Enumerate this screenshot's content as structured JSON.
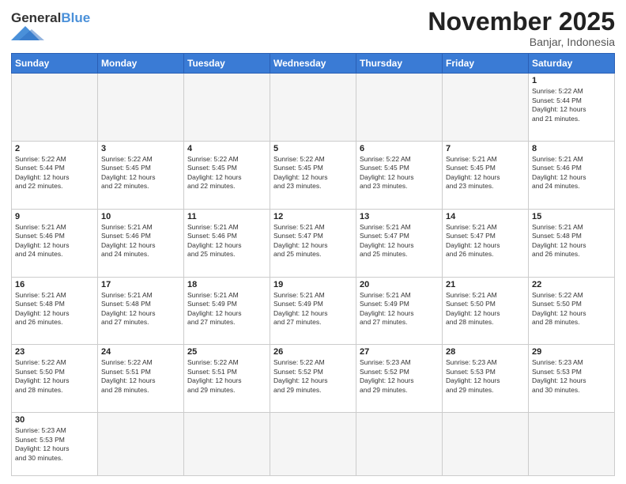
{
  "header": {
    "logo_general": "General",
    "logo_blue": "Blue",
    "month_title": "November 2025",
    "location": "Banjar, Indonesia"
  },
  "weekdays": [
    "Sunday",
    "Monday",
    "Tuesday",
    "Wednesday",
    "Thursday",
    "Friday",
    "Saturday"
  ],
  "days": {
    "1": {
      "sunrise": "5:22 AM",
      "sunset": "5:44 PM",
      "daylight": "12 hours and 21 minutes."
    },
    "2": {
      "sunrise": "5:22 AM",
      "sunset": "5:44 PM",
      "daylight": "12 hours and 22 minutes."
    },
    "3": {
      "sunrise": "5:22 AM",
      "sunset": "5:45 PM",
      "daylight": "12 hours and 22 minutes."
    },
    "4": {
      "sunrise": "5:22 AM",
      "sunset": "5:45 PM",
      "daylight": "12 hours and 22 minutes."
    },
    "5": {
      "sunrise": "5:22 AM",
      "sunset": "5:45 PM",
      "daylight": "12 hours and 23 minutes."
    },
    "6": {
      "sunrise": "5:22 AM",
      "sunset": "5:45 PM",
      "daylight": "12 hours and 23 minutes."
    },
    "7": {
      "sunrise": "5:21 AM",
      "sunset": "5:45 PM",
      "daylight": "12 hours and 23 minutes."
    },
    "8": {
      "sunrise": "5:21 AM",
      "sunset": "5:46 PM",
      "daylight": "12 hours and 24 minutes."
    },
    "9": {
      "sunrise": "5:21 AM",
      "sunset": "5:46 PM",
      "daylight": "12 hours and 24 minutes."
    },
    "10": {
      "sunrise": "5:21 AM",
      "sunset": "5:46 PM",
      "daylight": "12 hours and 24 minutes."
    },
    "11": {
      "sunrise": "5:21 AM",
      "sunset": "5:46 PM",
      "daylight": "12 hours and 25 minutes."
    },
    "12": {
      "sunrise": "5:21 AM",
      "sunset": "5:47 PM",
      "daylight": "12 hours and 25 minutes."
    },
    "13": {
      "sunrise": "5:21 AM",
      "sunset": "5:47 PM",
      "daylight": "12 hours and 25 minutes."
    },
    "14": {
      "sunrise": "5:21 AM",
      "sunset": "5:47 PM",
      "daylight": "12 hours and 26 minutes."
    },
    "15": {
      "sunrise": "5:21 AM",
      "sunset": "5:48 PM",
      "daylight": "12 hours and 26 minutes."
    },
    "16": {
      "sunrise": "5:21 AM",
      "sunset": "5:48 PM",
      "daylight": "12 hours and 26 minutes."
    },
    "17": {
      "sunrise": "5:21 AM",
      "sunset": "5:48 PM",
      "daylight": "12 hours and 27 minutes."
    },
    "18": {
      "sunrise": "5:21 AM",
      "sunset": "5:49 PM",
      "daylight": "12 hours and 27 minutes."
    },
    "19": {
      "sunrise": "5:21 AM",
      "sunset": "5:49 PM",
      "daylight": "12 hours and 27 minutes."
    },
    "20": {
      "sunrise": "5:21 AM",
      "sunset": "5:49 PM",
      "daylight": "12 hours and 27 minutes."
    },
    "21": {
      "sunrise": "5:21 AM",
      "sunset": "5:50 PM",
      "daylight": "12 hours and 28 minutes."
    },
    "22": {
      "sunrise": "5:22 AM",
      "sunset": "5:50 PM",
      "daylight": "12 hours and 28 minutes."
    },
    "23": {
      "sunrise": "5:22 AM",
      "sunset": "5:50 PM",
      "daylight": "12 hours and 28 minutes."
    },
    "24": {
      "sunrise": "5:22 AM",
      "sunset": "5:51 PM",
      "daylight": "12 hours and 28 minutes."
    },
    "25": {
      "sunrise": "5:22 AM",
      "sunset": "5:51 PM",
      "daylight": "12 hours and 29 minutes."
    },
    "26": {
      "sunrise": "5:22 AM",
      "sunset": "5:52 PM",
      "daylight": "12 hours and 29 minutes."
    },
    "27": {
      "sunrise": "5:23 AM",
      "sunset": "5:52 PM",
      "daylight": "12 hours and 29 minutes."
    },
    "28": {
      "sunrise": "5:23 AM",
      "sunset": "5:53 PM",
      "daylight": "12 hours and 29 minutes."
    },
    "29": {
      "sunrise": "5:23 AM",
      "sunset": "5:53 PM",
      "daylight": "12 hours and 30 minutes."
    },
    "30": {
      "sunrise": "5:23 AM",
      "sunset": "5:53 PM",
      "daylight": "12 hours and 30 minutes."
    }
  },
  "labels": {
    "sunrise": "Sunrise:",
    "sunset": "Sunset:",
    "daylight": "Daylight:"
  }
}
